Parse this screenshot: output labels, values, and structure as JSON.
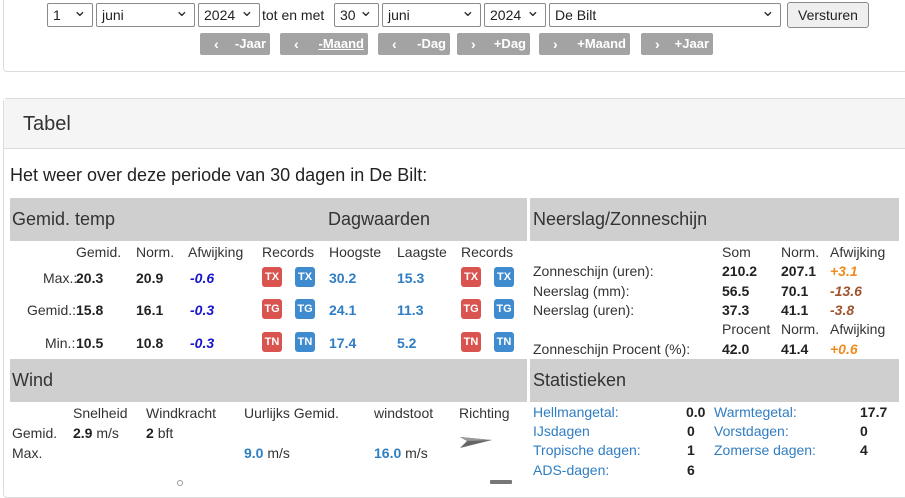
{
  "form": {
    "from_day": "1",
    "from_month": "juni",
    "from_year": "2024",
    "between_label": "tot en met",
    "to_day": "30",
    "to_month": "juni",
    "to_year": "2024",
    "location": "De Bilt",
    "submit_label": "Versturen",
    "nav_buttons": [
      "-Jaar",
      "-Maand",
      "-Dag",
      "+Dag",
      "+Maand",
      "+Jaar"
    ]
  },
  "panel": {
    "title": "Tabel",
    "intro": "Het weer over deze periode van 30 dagen in De Bilt:"
  },
  "temperature": {
    "section_title": "Gemid. temp",
    "day_values_title": "Dagwaarden",
    "col_gemid": "Gemid.",
    "col_norm": "Norm.",
    "col_afwijking": "Afwijking",
    "col_records": "Records",
    "col_hoogste": "Hoogste",
    "col_laagste": "Laagste",
    "col_records2": "Records",
    "rows": [
      {
        "label": "Max.:",
        "gemid": "20.3",
        "norm": "20.9",
        "afwijking": "-0.6",
        "code": "TX",
        "hoogste": "30.2",
        "laagste": "15.3"
      },
      {
        "label": "Gemid.:",
        "gemid": "15.8",
        "norm": "16.1",
        "afwijking": "-0.3",
        "code": "TG",
        "hoogste": "24.1",
        "laagste": "11.3"
      },
      {
        "label": "Min.:",
        "gemid": "10.5",
        "norm": "10.8",
        "afwijking": "-0.3",
        "code": "TN",
        "hoogste": "17.4",
        "laagste": "5.2"
      }
    ]
  },
  "neerslag": {
    "section_title": "Neerslag/Zonneschijn",
    "col_som": "Som",
    "col_norm": "Norm.",
    "col_afwijking": "Afwijking",
    "col_procent": "Procent",
    "rows": [
      {
        "label": "Zonneschijn (uren):",
        "som": "210.2",
        "norm": "207.1",
        "afwijking": "+3.1"
      },
      {
        "label": "Neerslag (mm):",
        "som": "56.5",
        "norm": "70.1",
        "afwijking": "-13.6"
      },
      {
        "label": "Neerslag (uren):",
        "som": "37.3",
        "norm": "41.1",
        "afwijking": "-3.8"
      }
    ],
    "procent_row": {
      "label": "Zonneschijn Procent (%):",
      "procent": "42.0",
      "norm": "41.4",
      "afwijking": "+0.6"
    }
  },
  "wind": {
    "section_title": "Wind",
    "col_snelheid": "Snelheid",
    "col_windkracht": "Windkracht",
    "col_uurlijks": "Uurlijks Gemid.",
    "col_windstoot": "windstoot",
    "col_richting": "Richting",
    "gemid_label": "Gemid.",
    "max_label": "Max.",
    "snelheid": "2.9",
    "snelheid_unit": "m/s",
    "windkracht": "2",
    "windkracht_unit": "bft",
    "uurlijks_max": "9.0",
    "uurlijks_unit": "m/s",
    "windstoot_max": "16.0",
    "windstoot_unit": "m/s"
  },
  "statistieken": {
    "section_title": "Statistieken",
    "left": [
      {
        "label": "Hellmangetal:",
        "value": "0.0"
      },
      {
        "label": "IJsdagen",
        "value": "0"
      },
      {
        "label": "Tropische dagen:",
        "value": "1"
      },
      {
        "label": "ADS-dagen:",
        "value": "6"
      }
    ],
    "right": [
      {
        "label": "Warmtegetal:",
        "value": "17.7"
      },
      {
        "label": "Vorstdagen:",
        "value": "0"
      },
      {
        "label": "Zomerse dagen:",
        "value": "4"
      }
    ]
  },
  "colors": {
    "record_red": "#d9534f",
    "record_blue": "#3f8bd0",
    "link_blue": "#2f7dc2",
    "negative_blue": "#1515cc",
    "positive_orange": "#ef8b1d",
    "section_gray": "#cfcfcf"
  }
}
